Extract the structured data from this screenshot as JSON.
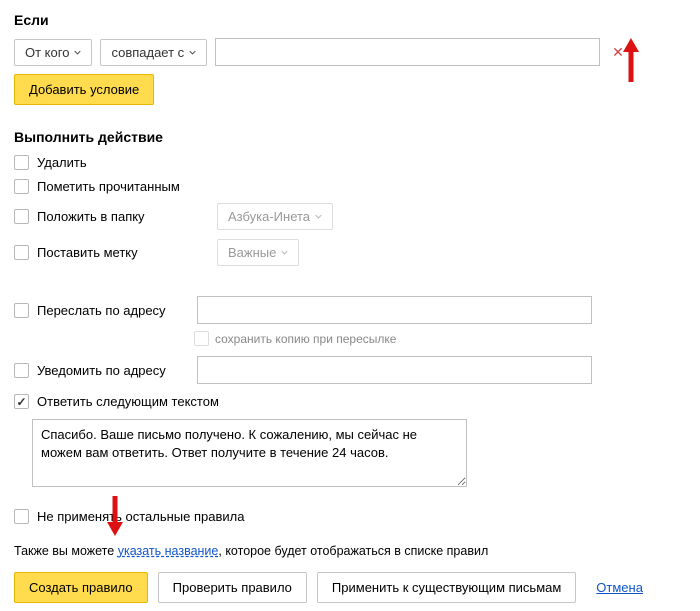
{
  "condition": {
    "title": "Если",
    "field_select": "От кого",
    "match_select": "совпадает с",
    "value": "",
    "add_button": "Добавить условие"
  },
  "action": {
    "title": "Выполнить действие",
    "delete": "Удалить",
    "mark_read": "Пометить прочитанным",
    "move_folder": "Положить в папку",
    "folder_value": "Азбука-Инета",
    "set_label": "Поставить метку",
    "label_value": "Важные",
    "forward": "Переслать по адресу",
    "forward_keep": "сохранить копию при пересылке",
    "notify": "Уведомить по адресу",
    "reply": "Ответить следующим текстом",
    "reply_text": "Спасибо. Ваше письмо получено. К сожалению, мы сейчас не можем вам ответить. Ответ получите в течение 24 часов.",
    "no_other": "Не применять остальные правила"
  },
  "hint": {
    "before": "Также вы можете ",
    "link": "указать название",
    "after": ", которое будет отображаться в списке правил"
  },
  "footer": {
    "create": "Создать правило",
    "check": "Проверить правило",
    "apply": "Применить к существующим письмам",
    "cancel": "Отмена"
  }
}
